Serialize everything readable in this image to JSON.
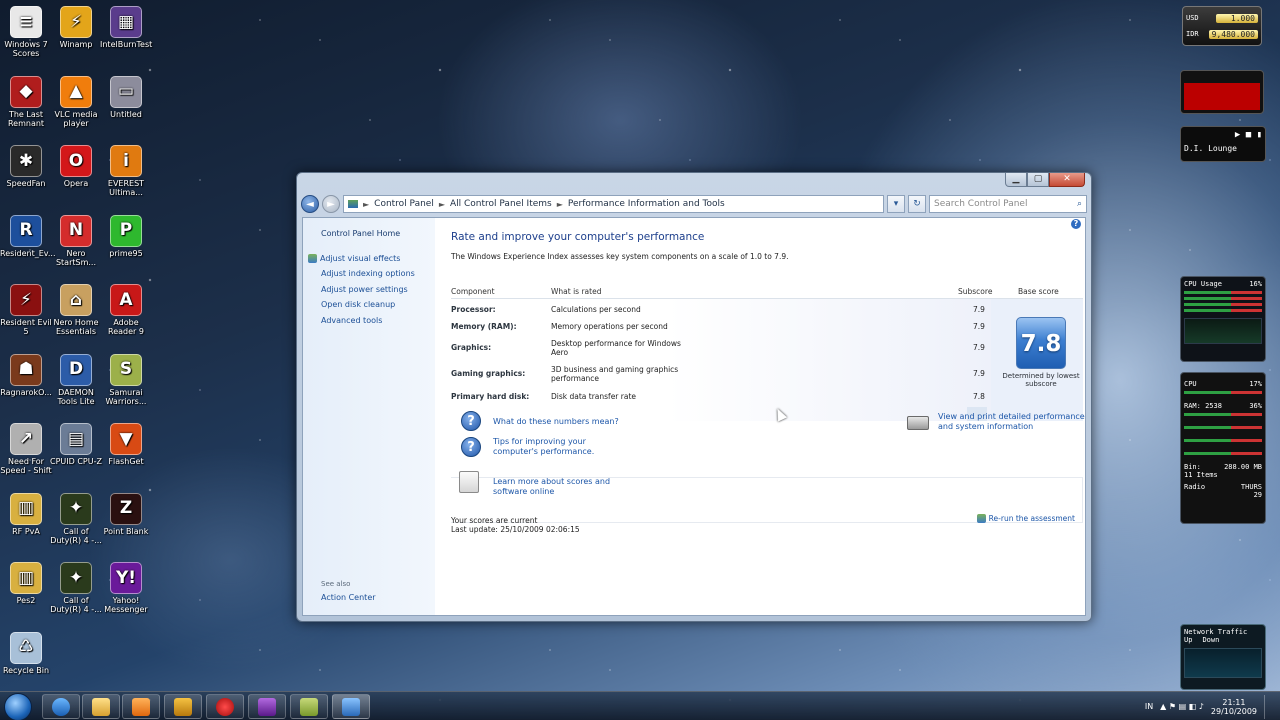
{
  "desktop_icons": [
    {
      "label": "Windows 7 Scores",
      "color": "#e8e8e8",
      "glyph": "≡"
    },
    {
      "label": "Winamp",
      "color": "#e3a51a",
      "glyph": "⚡"
    },
    {
      "label": "IntelBurnTest",
      "color": "#5a3c8c",
      "glyph": "▦"
    },
    {
      "label": "The Last Remnant",
      "color": "#b01d1d",
      "glyph": "◆"
    },
    {
      "label": "VLC media player",
      "color": "#f07d0c",
      "glyph": "▲"
    },
    {
      "label": "Untitled",
      "color": "#8c8c9c",
      "glyph": "▭"
    },
    {
      "label": "SpeedFan",
      "color": "#2a2a2a",
      "glyph": "✱"
    },
    {
      "label": "Opera",
      "color": "#d3171a",
      "glyph": "O"
    },
    {
      "label": "EVEREST Ultima...",
      "color": "#e07a10",
      "glyph": "i"
    },
    {
      "label": "Resident_Ev...",
      "color": "#1d4f9c",
      "glyph": "R"
    },
    {
      "label": "Nero StartSm...",
      "color": "#d42c2c",
      "glyph": "N"
    },
    {
      "label": "prime95",
      "color": "#2eb82e",
      "glyph": "P"
    },
    {
      "label": "Resident Evil 5",
      "color": "#8a1010",
      "glyph": "⚡"
    },
    {
      "label": "Nero Home Essentials",
      "color": "#c8a060",
      "glyph": "⌂"
    },
    {
      "label": "Adobe Reader 9",
      "color": "#c81818",
      "glyph": "A"
    },
    {
      "label": "RagnarokO...",
      "color": "#7a3a1c",
      "glyph": "☗"
    },
    {
      "label": "DAEMON Tools Lite",
      "color": "#2c5ca8",
      "glyph": "D"
    },
    {
      "label": "Samurai Warriors...",
      "color": "#9cb04a",
      "glyph": "S"
    },
    {
      "label": "Need For Speed - Shift",
      "color": "#b0b0b0",
      "glyph": "↗"
    },
    {
      "label": "CPUID CPU-Z",
      "color": "#6b7c96",
      "glyph": "▤"
    },
    {
      "label": "FlashGet",
      "color": "#d84a14",
      "glyph": "▼"
    },
    {
      "label": "RF PvA",
      "color": "#d8b040",
      "glyph": "▥"
    },
    {
      "label": "Call of Duty(R) 4 -...",
      "color": "#2a3a1c",
      "glyph": "✦"
    },
    {
      "label": "Point Blank",
      "color": "#2a1010",
      "glyph": "Z"
    },
    {
      "label": "Pes2",
      "color": "#d8b040",
      "glyph": "▥"
    },
    {
      "label": "Call of Duty(R) 4 -...",
      "color": "#2a3a1c",
      "glyph": "✦"
    },
    {
      "label": "Yahoo! Messenger",
      "color": "#6a1a9a",
      "glyph": "Y!"
    },
    {
      "label": "Recycle Bin",
      "color": "#a8c0d8",
      "glyph": "♺"
    }
  ],
  "window": {
    "controls": {
      "minimize": "▁",
      "maximize": "▢",
      "close": "✕"
    },
    "nav": {
      "back": "◄",
      "forward": "►",
      "dropdown": "▾",
      "refresh": "↻"
    },
    "breadcrumb": [
      "Control Panel",
      "All Control Panel Items",
      "Performance Information and Tools"
    ],
    "search_placeholder": "Search Control Panel",
    "help": "?",
    "left_pane": {
      "home": "Control Panel Home",
      "links": [
        "Adjust visual effects",
        "Adjust indexing options",
        "Adjust power settings",
        "Open disk cleanup",
        "Advanced tools"
      ],
      "see_also": "See also",
      "action_center": "Action Center"
    },
    "main": {
      "title": "Rate and improve your computer's performance",
      "description": "The Windows Experience Index assesses key system components on a scale of 1.0 to 7.9.",
      "headers": {
        "component": "Component",
        "rated": "What is rated",
        "subscore": "Subscore",
        "base": "Base score"
      },
      "rows": [
        {
          "component": "Processor:",
          "rated": "Calculations per second",
          "subscore": "7.9"
        },
        {
          "component": "Memory (RAM):",
          "rated": "Memory operations per second",
          "subscore": "7.9"
        },
        {
          "component": "Graphics:",
          "rated": "Desktop performance for Windows Aero",
          "subscore": "7.9"
        },
        {
          "component": "Gaming graphics:",
          "rated": "3D business and gaming graphics performance",
          "subscore": "7.9"
        },
        {
          "component": "Primary hard disk:",
          "rated": "Disk data transfer rate",
          "subscore": "7.8"
        }
      ],
      "base_score": "7.8",
      "base_label": "Determined by lowest subscore",
      "links": {
        "numbers": "What do these numbers mean?",
        "tips": "Tips for improving your computer's performance.",
        "learn": "Learn more about scores and software online",
        "print": "View and print detailed performance and system information"
      },
      "status_line1": "Your scores are current",
      "status_line2": "Last update: 25/10/2009 02:06:15",
      "rerun": "Re-run the assessment"
    }
  },
  "gadgets": {
    "currency": [
      {
        "code": "USD",
        "value": "1.000"
      },
      {
        "code": "IDR",
        "value": "9,480.000"
      }
    ],
    "media": {
      "station": "D.I. Lounge",
      "controls": "▶ ■ ▮"
    },
    "cpu": {
      "title": "CPU Usage",
      "value": "16%"
    },
    "sys": {
      "cpu": "CPU",
      "cpu_val": "17%",
      "ram": "RAM: 2538",
      "ram_val": "36%",
      "bin": "Bin:",
      "bin_val": "288.00 MB",
      "items": "11 Items",
      "radio": "Radio",
      "day": "THURS",
      "date": "29"
    },
    "net": {
      "title": "Network Traffic",
      "up": "Up",
      "down": "Down"
    }
  },
  "taskbar": {
    "tray_lang": "IN",
    "time": "21:11",
    "date": "29/10/2009"
  },
  "colors": {
    "accent": "#1d3f8c",
    "link": "#1c56a8",
    "badge": "#3c7ed0"
  }
}
